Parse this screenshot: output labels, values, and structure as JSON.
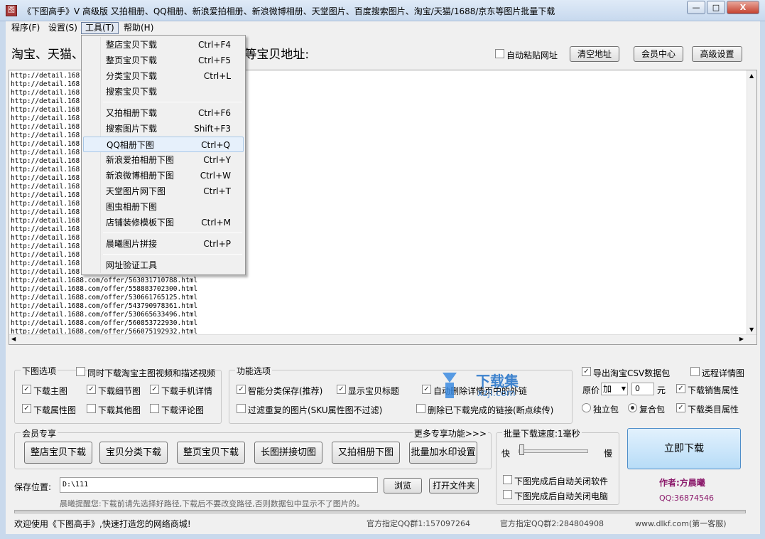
{
  "window": {
    "icon_glyph": "图",
    "title": "《下图高手》V      高级版   又拍相册、QQ相册、新浪爱拍相册、新浪微博相册、天堂图片、百度搜索图片、淘宝/天猫/1688/京东等图片批量下载",
    "minimize": "—",
    "maximize": "□",
    "close": "X"
  },
  "menubar": [
    "程序(F)",
    "设置(S)",
    "工具(T)",
    "帮助(H)"
  ],
  "toolbar": {
    "url_label": "淘宝、天猫、                                        卖通、易贝、亚马逊、拼多多等宝贝地址:",
    "auto_paste": "自动粘贴网址",
    "clear": "清空地址",
    "member": "会员中心",
    "advanced": "高级设置"
  },
  "urls": [
    "http://detail.168",
    "http://detail.168",
    "http://detail.168",
    "http://detail.168",
    "http://detail.168",
    "http://detail.168",
    "http://detail.168",
    "http://detail.168",
    "http://detail.168",
    "http://detail.168",
    "http://detail.168",
    "http://detail.168",
    "http://detail.168",
    "http://detail.168",
    "http://detail.168",
    "http://detail.168",
    "http://detail.168",
    "http://detail.168",
    "http://detail.168",
    "http://detail.168",
    "http://detail.168",
    "http://detail.168",
    "http://detail.168",
    "http://detail.168",
    "http://detail.1688.com/offer/563031710788.html",
    "http://detail.1688.com/offer/558883702300.html",
    "http://detail.1688.com/offer/530661765125.html",
    "http://detail.1688.com/offer/543790978361.html",
    "http://detail.1688.com/offer/530665633496.html",
    "http://detail.1688.com/offer/560853722930.html",
    "http://detail.1688.com/offer/566075192932.html"
  ],
  "tools_menu": [
    {
      "label": "整店宝贝下载",
      "shortcut": "Ctrl+F4"
    },
    {
      "label": "整页宝贝下载",
      "shortcut": "Ctrl+F5"
    },
    {
      "label": "分类宝贝下载",
      "shortcut": "Ctrl+L"
    },
    {
      "label": "搜索宝贝下载",
      "shortcut": ""
    },
    {
      "label": "又拍相册下载",
      "shortcut": "Ctrl+F6"
    },
    {
      "label": "搜索图片下载",
      "shortcut": "Shift+F3"
    },
    {
      "label": "QQ相册下图",
      "shortcut": "Ctrl+Q"
    },
    {
      "label": "新浪爱拍相册下图",
      "shortcut": "Ctrl+Y"
    },
    {
      "label": "新浪微博相册下图",
      "shortcut": "Ctrl+W"
    },
    {
      "label": "天堂图片网下图",
      "shortcut": "Ctrl+T"
    },
    {
      "label": "图虫相册下图",
      "shortcut": ""
    },
    {
      "label": "店铺装修模板下图",
      "shortcut": "Ctrl+M"
    },
    {
      "label": "晨曦图片拼接",
      "shortcut": "Ctrl+P"
    },
    {
      "label": "网址验证工具",
      "shortcut": ""
    }
  ],
  "download_options": {
    "title": "下图选项",
    "video": "同时下载淘宝主图视频和描述视频",
    "main_img": "下载主图",
    "detail_img": "下载细节图",
    "mobile_detail": "下载手机详情",
    "attr_img": "下载属性图",
    "other_img": "下载其他图",
    "comment_img": "下载评论图"
  },
  "function_options": {
    "title": "功能选项",
    "smart_save": "智能分类保存(推荐)",
    "show_title": "显示宝贝标题",
    "auto_remove": "自动删除详情页中的外链",
    "filter_dup": "过滤重复的图片(SKU属性图不过滤)",
    "delete_done": "删除已下载完成的链接(断点续传)"
  },
  "csv_options": {
    "export_csv": "导出淘宝CSV数据包",
    "remote_detail": "远程详情图",
    "price_label": "原价",
    "price_op": "加",
    "price_value": "0",
    "price_unit": "元",
    "sales_attr": "下载销售属性",
    "single_pack": "独立包",
    "combo_pack": "复合包",
    "category_attr": "下载类目属性"
  },
  "member": {
    "title": "会员专享",
    "more": "更多专享功能>>>",
    "buttons": [
      "整店宝贝下载",
      "宝贝分类下载",
      "整页宝贝下载",
      "长图拼接切图",
      "又拍相册下图",
      "批量加水印设置"
    ]
  },
  "speed": {
    "title": "批量下载速度:1毫秒",
    "fast": "快",
    "slow": "慢",
    "close_app": "下图完成后自动关闭软件",
    "close_pc": "下图完成后自动关闭电脑"
  },
  "start": "立即下载",
  "author": "作者:方晨曦",
  "qq": "QQ:36874546",
  "save": {
    "label": "保存位置:",
    "path": "D:\\111",
    "browse": "浏览",
    "open_folder": "打开文件夹",
    "hint": "晨曦提醒您:下载前请先选择好路径,下载后不要改变路径,否则数据包中显示不了图片的。"
  },
  "status": {
    "welcome": "欢迎使用《下图高手》,快速打造您的网络商城!",
    "qq1": "官方指定QQ群1:157097264",
    "qq2": "官方指定QQ群2:284804908",
    "site": "www.dlkf.com(第一客服)"
  },
  "watermark": {
    "text": "下载集",
    "sub": "xzji.com"
  },
  "colors": {
    "accent": "#1e6fc8",
    "author": "#8b1a6b"
  }
}
